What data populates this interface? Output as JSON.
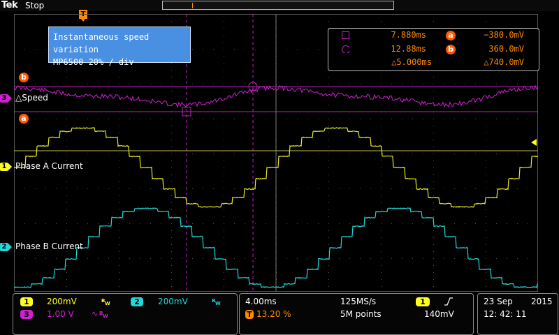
{
  "header": {
    "brand": "Tek",
    "run_status": "Stop",
    "trigger_position_label": "T"
  },
  "annotation": {
    "line1": "Instantaneous speed variation",
    "line2": "MP6500 20% / div"
  },
  "cursor_readout": {
    "row1_time": "7.880ms",
    "row1_tag": "a",
    "row1_value": "−380.0mV",
    "row2_time": "12.88ms",
    "row2_tag": "b",
    "row2_value": "360.0mV",
    "delta_time": "△5.000ms",
    "delta_value": "△740.0mV"
  },
  "traces": {
    "ch3": {
      "number": "3",
      "label": "△Speed",
      "color": "#d020d0"
    },
    "ch1": {
      "number": "1",
      "label": "Phase A Current",
      "color": "#ffff20"
    },
    "ch2": {
      "number": "2",
      "label": "Phase B Current",
      "color": "#20d8d8"
    }
  },
  "cursors": {
    "a_tag": "a",
    "b_tag": "b"
  },
  "vertical": {
    "ch1_num": "1",
    "ch1_scale": "200mV",
    "ch1_bw": "B",
    "ch2_num": "2",
    "ch2_scale": "200mV",
    "ch2_bw": "B",
    "ch3_num": "3",
    "ch3_scale": "1.00 V",
    "ch3_bw": "B"
  },
  "horizontal": {
    "time_div": "4.00ms",
    "sample_rate": "125MS/s",
    "trig_pos_icon": "T",
    "trig_pos_pct": "13.20 %",
    "record_length": "5M points",
    "trig_source": "1",
    "trig_slope_icon": "rising-edge-icon",
    "trig_level": "140mV"
  },
  "datetime": {
    "date": "23 Sep",
    "year": "2015",
    "time": "12: 42: 11"
  },
  "colors": {
    "ch1": "#ffff20",
    "ch2": "#20d8d8",
    "ch3": "#d020d0",
    "cursor_tag": "#ff5a00",
    "accent": "#ff8a00",
    "note_bg": "#4a90e2"
  }
}
